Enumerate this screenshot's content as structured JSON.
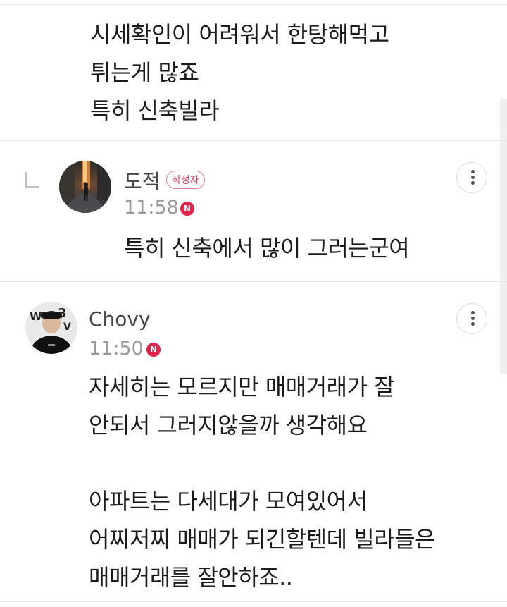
{
  "comments": [
    {
      "id": "comment-1",
      "lines_text": "시세확인이 어려워서 한탕해먹고\n튀는게 많죠\n특히 신축빌라"
    },
    {
      "id": "comment-2",
      "nickname": "도적",
      "badge": "작성자",
      "time": "11:58",
      "new_badge": "N",
      "lines_text": "특히 신축에서 많이 그러는군여",
      "is_reply": true
    },
    {
      "id": "comment-3",
      "nickname": "Chovy",
      "time": "11:50",
      "new_badge": "N",
      "lines_text": "자세히는 모르지만 매매거래가 잘\n안되서 그러지않을까 생각해요\n\n아파트는 다세대가 모여있어서\n어찌저찌 매매가 되긴할텐데 빌라들은\n매매거래를 잘안하죠.."
    }
  ],
  "icons": {
    "more": "more-vertical-icon",
    "reply": "reply-indent-icon",
    "new": "new-n-icon"
  },
  "colors": {
    "accent": "#e0224a",
    "author_badge": "#e0445f",
    "divider": "#e6e6e6",
    "muted": "#9a9a9a"
  }
}
